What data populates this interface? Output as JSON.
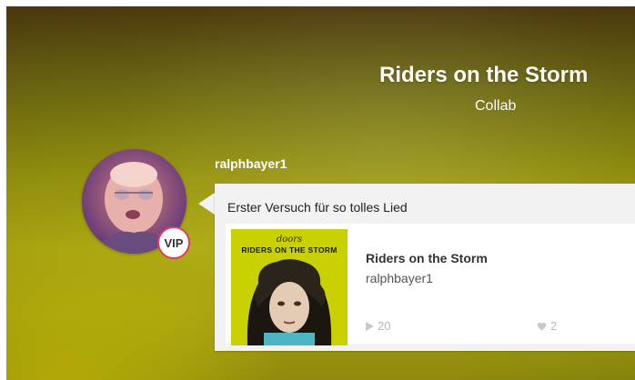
{
  "header": {
    "title": "Riders on the Storm",
    "subtitle": "Collab"
  },
  "post": {
    "username": "ralphbayer1",
    "badge": "VIP",
    "comment": "Erster Versuch für so tolles Lied",
    "track": {
      "title": "Riders on the Storm",
      "artist": "ralphbayer1",
      "cover_band_text": "doors",
      "cover_title_text": "RIDERS ON THE STORM",
      "plays": "20",
      "likes": "2"
    }
  },
  "colors": {
    "accent_badge_border": "#e23a63",
    "card_bg": "#f2f2f2",
    "cover_bg": "#c9d200"
  },
  "icons": {
    "plays": "play-icon",
    "likes": "heart-icon"
  }
}
